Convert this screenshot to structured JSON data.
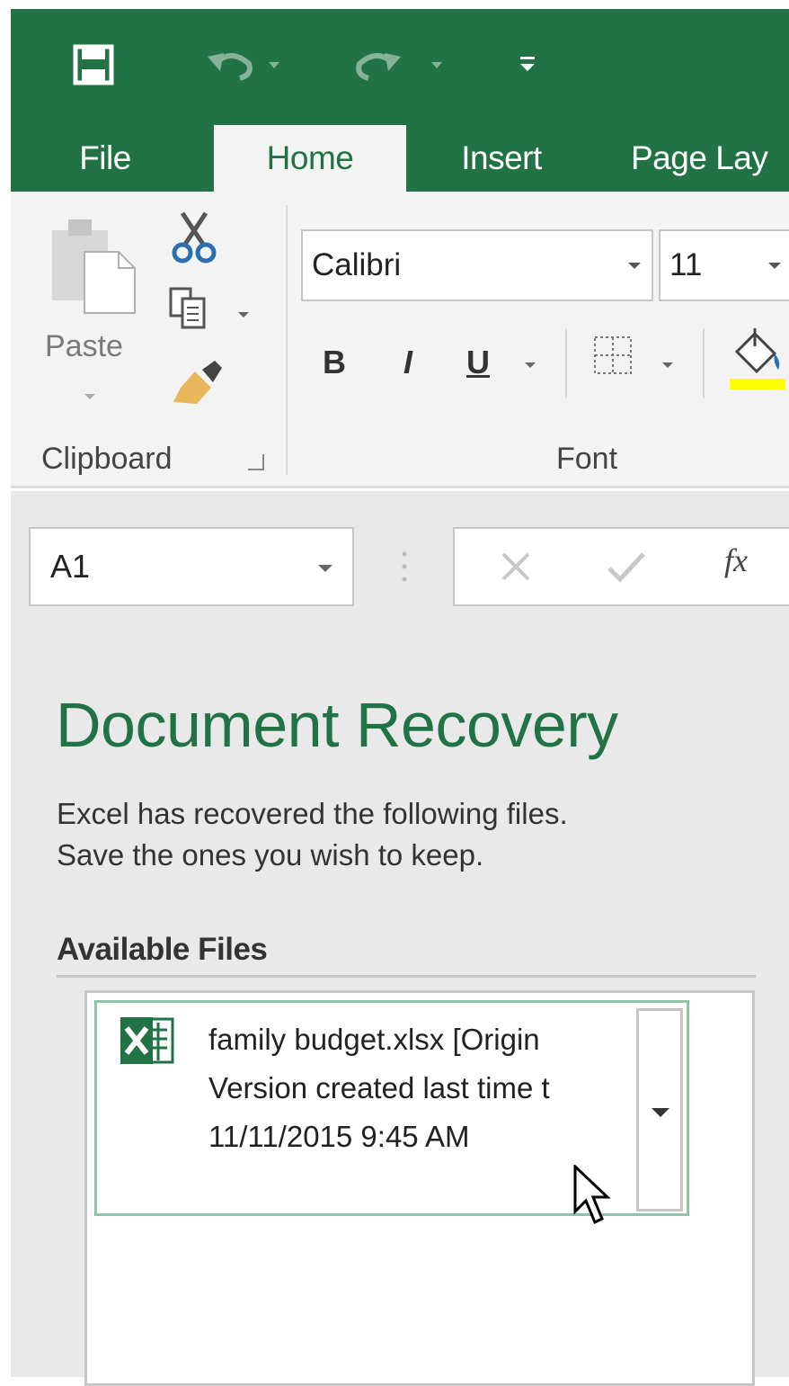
{
  "colors": {
    "accent": "#217346",
    "ribbon_bg": "#f3f3f3",
    "pane_bg": "#e9e9e9",
    "item_border": "#8ec5a6"
  },
  "quick_access": {
    "icons": [
      "save-icon",
      "undo-icon",
      "redo-icon",
      "customize-qat-icon"
    ]
  },
  "tabs": [
    {
      "label": "File"
    },
    {
      "label": "Home",
      "active": true
    },
    {
      "label": "Insert"
    },
    {
      "label": "Page Lay"
    }
  ],
  "clipboard": {
    "paste_label": "Paste",
    "group_label": "Clipboard"
  },
  "font": {
    "group_label": "Font",
    "font_name": "Calibri",
    "font_size": "11",
    "bold": "B",
    "italic": "I",
    "underline": "U"
  },
  "formula_bar": {
    "name_box": "A1",
    "fx": "fx"
  },
  "recovery": {
    "title": "Document Recovery",
    "description_line1": "Excel has recovered the following files.",
    "description_line2": "Save the ones you wish to keep.",
    "available_files_label": "Available Files",
    "files": [
      {
        "name": "family budget.xlsx  [Origin",
        "detail": "Version created last time t",
        "timestamp": "11/11/2015 9:45 AM"
      }
    ]
  }
}
